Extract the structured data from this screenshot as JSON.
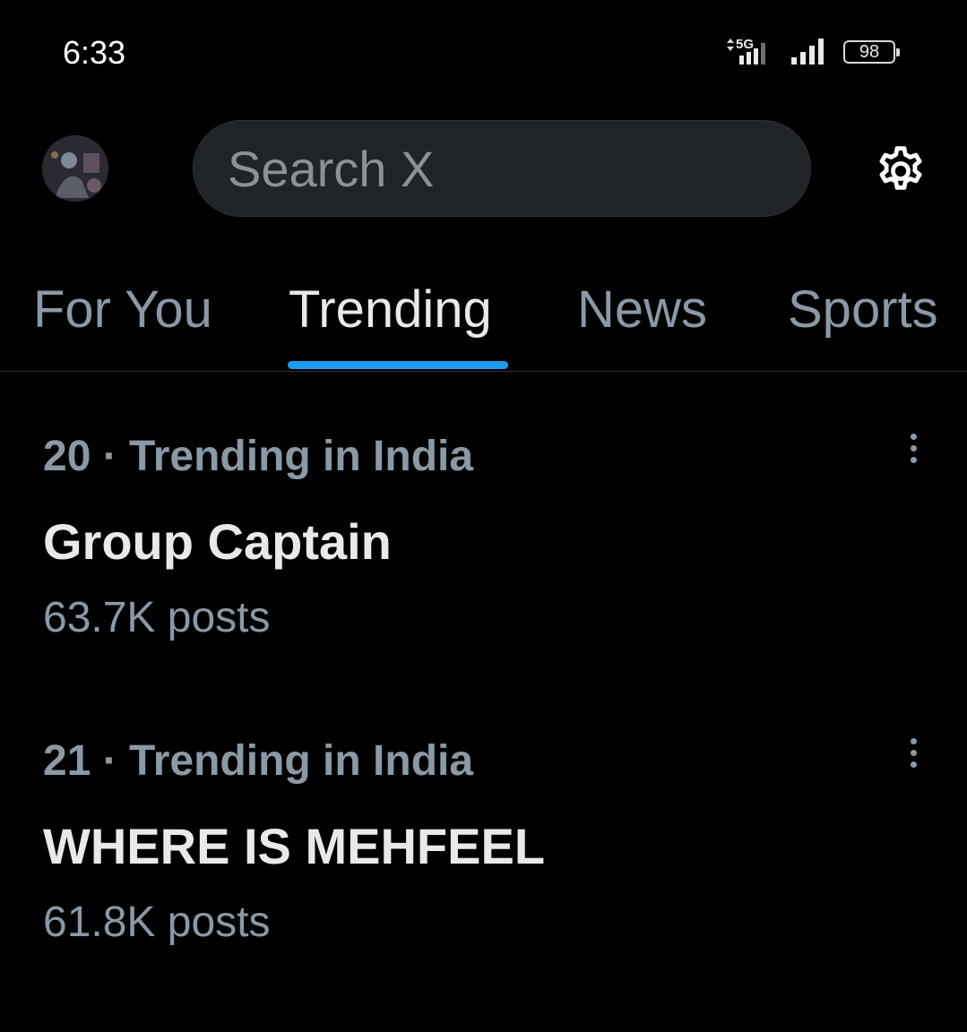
{
  "status_bar": {
    "time": "6:33",
    "network": "5G",
    "battery": "98"
  },
  "header": {
    "avatar_icon": "profile-avatar",
    "search_placeholder": "Search X",
    "settings_icon": "gear-icon"
  },
  "tabs": [
    {
      "label": "For You",
      "active": false
    },
    {
      "label": "Trending",
      "active": true
    },
    {
      "label": "News",
      "active": false
    },
    {
      "label": "Sports",
      "active": false
    }
  ],
  "trends": [
    {
      "context": "20 · Trending in India",
      "name": "Group Captain",
      "posts": "63.7K posts"
    },
    {
      "context": "21 · Trending in India",
      "name": "WHERE IS MEHFEEL",
      "posts": "61.8K posts"
    }
  ],
  "colors": {
    "background": "#000000",
    "accent": "#1d9bf0",
    "primary_text": "#e7e9ea",
    "secondary_text": "#8b98a5"
  }
}
